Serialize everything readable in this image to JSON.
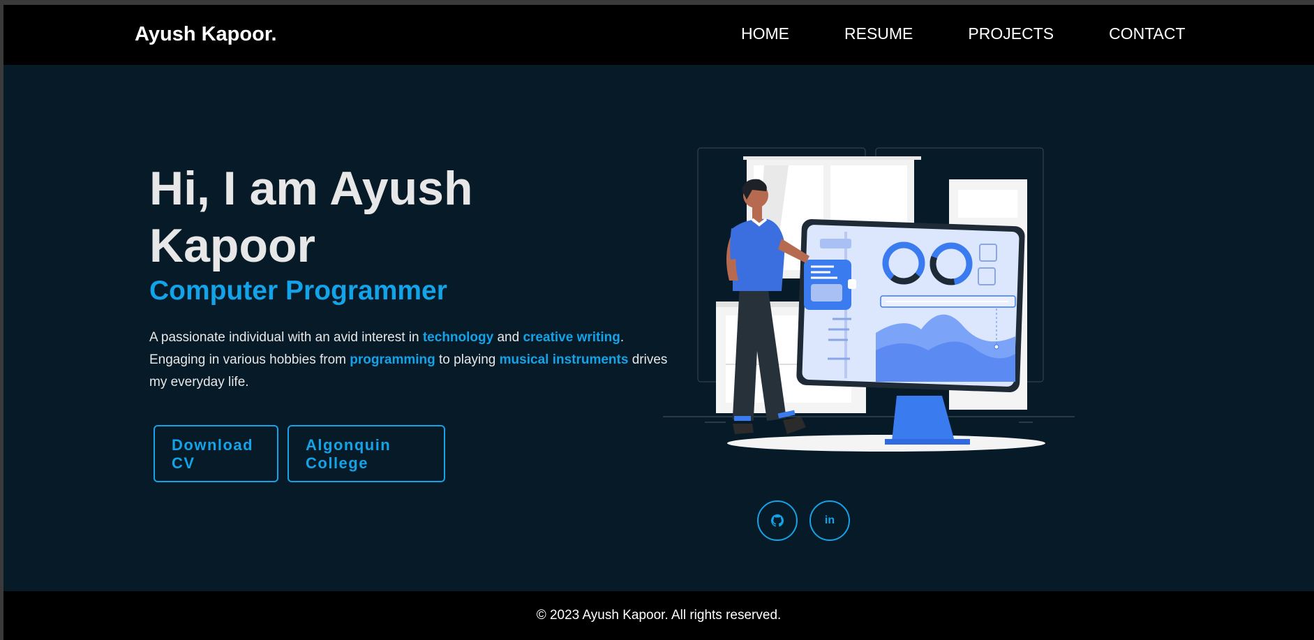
{
  "nav": {
    "brand": "Ayush Kapoor.",
    "links": [
      "HOME",
      "RESUME",
      "PROJECTS",
      "CONTACT"
    ]
  },
  "hero": {
    "title": "Hi, I am Ayush Kapoor",
    "subtitle": "Computer Programmer",
    "desc": {
      "p1": "A passionate individual with an avid interest in ",
      "h1": "technology",
      "p2": " and ",
      "h2": "creative writing",
      "p3": ". Engaging in various hobbies from ",
      "h3": "programming",
      "p4": " to playing ",
      "h4": "musical instruments",
      "p5": " drives my everyday life."
    },
    "buttons": {
      "cv_line1": "Download",
      "cv_line2": "CV",
      "college_line1": "Algonquin",
      "college_line2": "College"
    }
  },
  "social": {
    "github_icon": "github-icon",
    "linkedin_label": "in"
  },
  "footer": {
    "text": "© 2023 Ayush Kapoor. All rights reserved."
  },
  "colors": {
    "accent": "#13a3e8",
    "background": "#061a28",
    "nav_bg": "#000000"
  }
}
